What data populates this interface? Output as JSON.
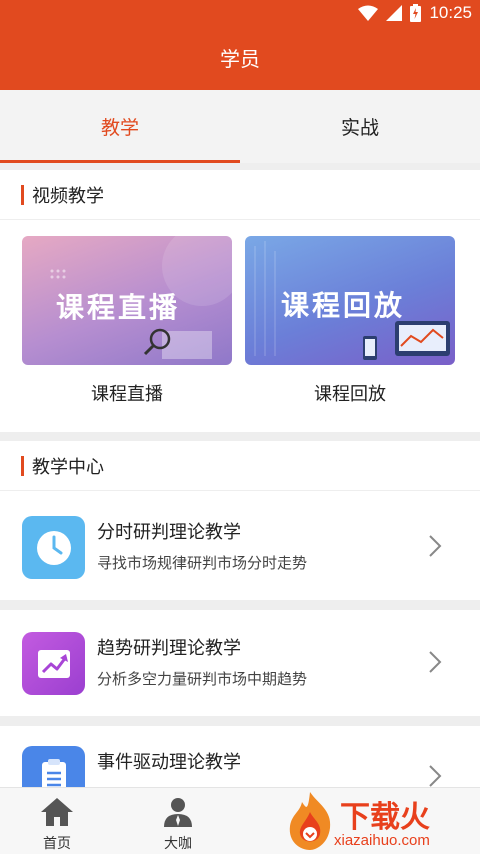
{
  "status_bar": {
    "time": "10:25"
  },
  "header": {
    "title": "学员"
  },
  "tabs": [
    {
      "label": "教学",
      "active": true
    },
    {
      "label": "实战",
      "active": false
    }
  ],
  "video_section": {
    "title": "视频教学",
    "cards": [
      {
        "banner_text": "课程直播",
        "label": "课程直播"
      },
      {
        "banner_text": "课程回放",
        "label": "课程回放"
      }
    ]
  },
  "teaching_center": {
    "title": "教学中心",
    "items": [
      {
        "title": "分时研判理论教学",
        "subtitle": "寻找市场规律研判市场分时走势",
        "icon": "clock-icon",
        "color": "#5bb8f0"
      },
      {
        "title": "趋势研判理论教学",
        "subtitle": "分析多空力量研判市场中期趋势",
        "icon": "trend-chart-icon",
        "color": "#b24bd9"
      },
      {
        "title": "事件驱动理论教学",
        "subtitle": "",
        "icon": "document-icon",
        "color": "#4a86e8"
      }
    ]
  },
  "bottom_nav": [
    {
      "label": "首页",
      "icon": "home-icon"
    },
    {
      "label": "大咖",
      "icon": "expert-person-icon"
    }
  ],
  "watermark": {
    "brand": "下载火",
    "domain": "xiazaihuo.com"
  },
  "colors": {
    "accent": "#e14a1f",
    "background": "#ffffff",
    "divider": "#eeeeee"
  }
}
